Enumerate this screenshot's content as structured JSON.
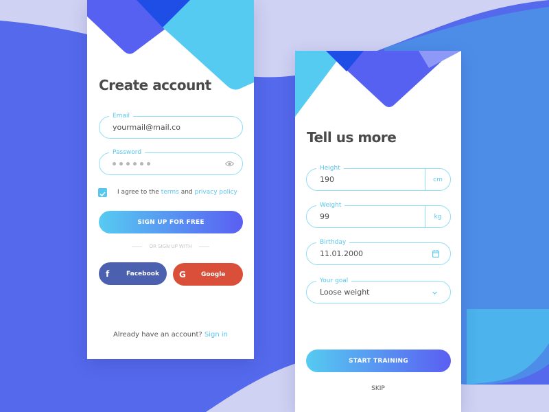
{
  "colors": {
    "accent": "#58c7ef",
    "primary": "#5a5ef2",
    "facebook": "#4c60b0",
    "google": "#d94f3a",
    "text_dark": "#4a4a4a",
    "bg_light": "#d0d2f3",
    "bg_blue": "#5270ec",
    "bg_cyan": "#4cb3ec"
  },
  "create_account": {
    "title": "Create account",
    "email": {
      "label": "Email",
      "value": "yourmail@mail.co"
    },
    "password": {
      "label": "Password",
      "masked_length": 6,
      "toggle_icon": "eye-icon"
    },
    "agree": {
      "checked": true,
      "prefix": "I agree to the",
      "terms_link": "terms",
      "middle": "and",
      "privacy_link": "privacy policy"
    },
    "signup_button": "SIGN UP FOR FREE",
    "divider": "OR SIGN UP WITH",
    "facebook_button": "Facebook",
    "google_button": "Google",
    "footer_text": "Already have an account?",
    "signin_link": "Sign in"
  },
  "tell_us_more": {
    "title": "Tell us more",
    "height": {
      "label": "Height",
      "value": "190",
      "unit": "cm"
    },
    "weight": {
      "label": "Weight",
      "value": "99",
      "unit": "kg"
    },
    "birthday": {
      "label": "Birthday",
      "value": "11.01.2000",
      "icon": "calendar-icon"
    },
    "goal": {
      "label": "Your goal",
      "value": "Loose weight",
      "icon": "chevron-down-icon"
    },
    "start_button": "START TRAINING",
    "skip_link": "SKIP"
  }
}
